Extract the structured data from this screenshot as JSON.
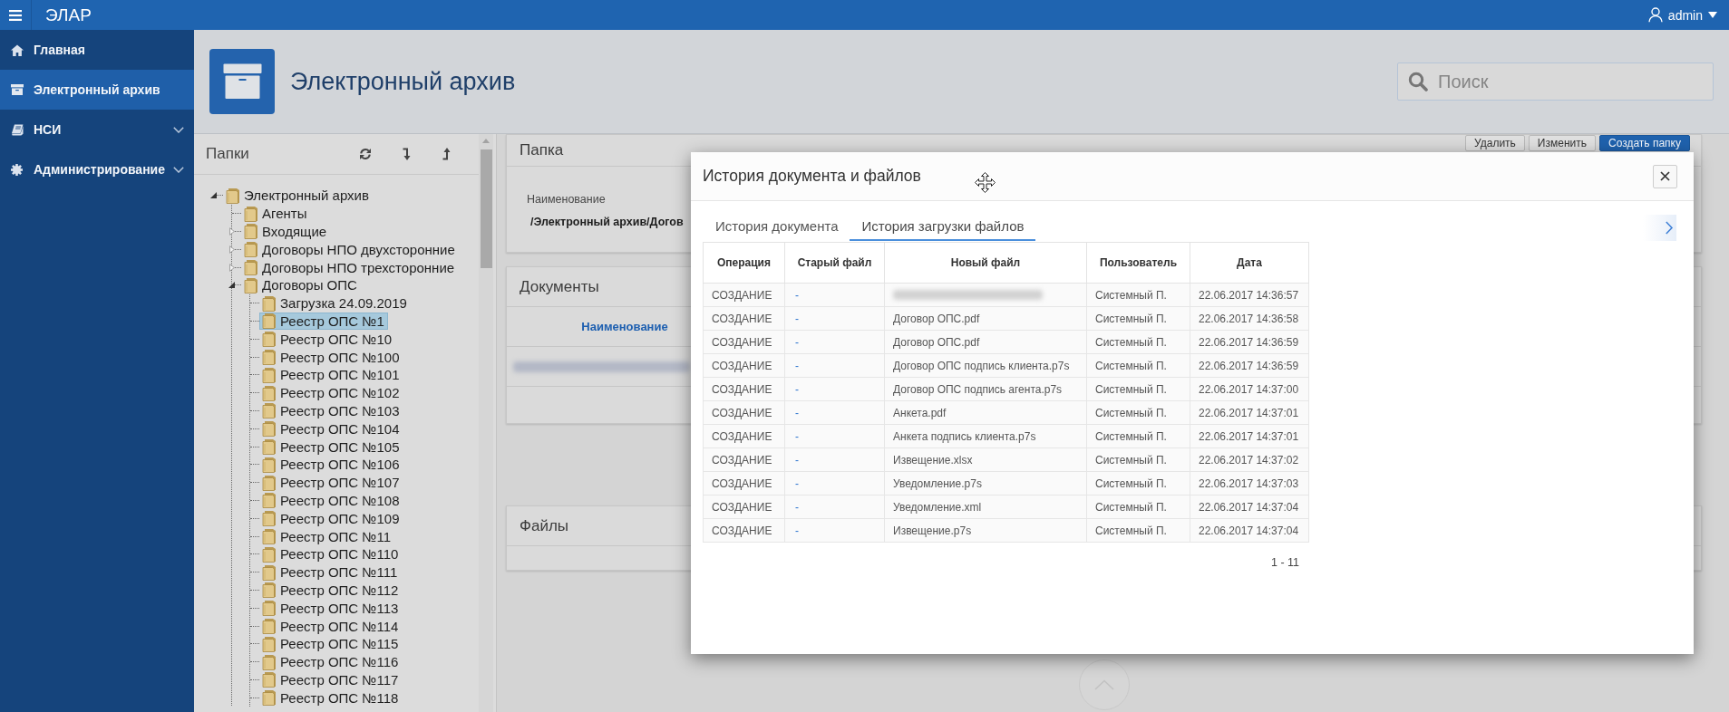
{
  "topbar": {
    "title": "ЭЛАР",
    "user": "admin"
  },
  "sidebar": {
    "items": [
      {
        "label": "Главная",
        "selected": false,
        "has_submenu": false
      },
      {
        "label": "Электронный архив",
        "selected": true,
        "has_submenu": false
      },
      {
        "label": "НСИ",
        "selected": false,
        "has_submenu": true
      },
      {
        "label": "Администрирование",
        "selected": false,
        "has_submenu": true
      }
    ]
  },
  "page_header": {
    "title": "Электронный архив",
    "search": {
      "placeholder": "Поиск"
    }
  },
  "folders_panel": {
    "title": "Папки",
    "tree": [
      {
        "label": "Электронный архив",
        "expanded": true,
        "selected": false,
        "children": [
          {
            "label": "Агенты",
            "selected": false
          },
          {
            "label": "Входящие",
            "expanded": false,
            "selected": false
          },
          {
            "label": "Договоры НПО двухсторонние",
            "expanded": false,
            "selected": false
          },
          {
            "label": "Договоры НПО трехсторонние",
            "expanded": false,
            "selected": false
          },
          {
            "label": "Договоры ОПС",
            "expanded": true,
            "selected": false,
            "children": [
              {
                "label": "Загрузка 24.09.2019",
                "selected": false
              },
              {
                "label": "Реестр ОПС №1",
                "selected": true
              },
              {
                "label": "Реестр ОПС №10",
                "selected": false
              },
              {
                "label": "Реестр ОПС №100",
                "selected": false
              },
              {
                "label": "Реестр ОПС №101",
                "selected": false
              },
              {
                "label": "Реестр ОПС №102",
                "selected": false
              },
              {
                "label": "Реестр ОПС №103",
                "selected": false
              },
              {
                "label": "Реестр ОПС №104",
                "selected": false
              },
              {
                "label": "Реестр ОПС №105",
                "selected": false
              },
              {
                "label": "Реестр ОПС №106",
                "selected": false
              },
              {
                "label": "Реестр ОПС №107",
                "selected": false
              },
              {
                "label": "Реестр ОПС №108",
                "selected": false
              },
              {
                "label": "Реестр ОПС №109",
                "selected": false
              },
              {
                "label": "Реестр ОПС №11",
                "selected": false
              },
              {
                "label": "Реестр ОПС №110",
                "selected": false
              },
              {
                "label": "Реестр ОПС №111",
                "selected": false
              },
              {
                "label": "Реестр ОПС №112",
                "selected": false
              },
              {
                "label": "Реестр ОПС №113",
                "selected": false
              },
              {
                "label": "Реестр ОПС №114",
                "selected": false
              },
              {
                "label": "Реестр ОПС №115",
                "selected": false
              },
              {
                "label": "Реестр ОПС №116",
                "selected": false
              },
              {
                "label": "Реестр ОПС №117",
                "selected": false
              },
              {
                "label": "Реестр ОПС №118",
                "selected": false
              }
            ]
          }
        ]
      }
    ]
  },
  "folder_panel": {
    "title": "Папка",
    "buttons": [
      {
        "label": "Удалить",
        "kind": "default"
      },
      {
        "label": "Изменить",
        "kind": "default"
      },
      {
        "label": "Создать папку",
        "kind": "primary"
      }
    ],
    "field_label": "Наименование",
    "field_value": "/Электронный архив/Догов"
  },
  "documents_panel": {
    "title": "Документы",
    "columns": [
      "Наименование"
    ],
    "rows": [
      {
        "name_blurred": true
      }
    ]
  },
  "files_panel": {
    "title": "Файлы"
  },
  "dialog": {
    "title": "История документа и файлов",
    "tabs": [
      {
        "label": "История документа",
        "selected": false
      },
      {
        "label": "История загрузки файлов",
        "selected": true
      }
    ],
    "table": {
      "columns": [
        "Операция",
        "Старый файл",
        "Новый файл",
        "Пользователь",
        "Дата"
      ],
      "rows": [
        {
          "operation": "СОЗДАНИЕ",
          "old_file": "-",
          "new_file_blurred": true,
          "user": "Системный П.",
          "date": "22.06.2017 14:36:57"
        },
        {
          "operation": "СОЗДАНИЕ",
          "old_file": "-",
          "new_file_blurred": false,
          "new_file": "Договор ОПС.pdf",
          "user": "Системный П.",
          "date": "22.06.2017 14:36:58"
        },
        {
          "operation": "СОЗДАНИЕ",
          "old_file": "-",
          "new_file_blurred": false,
          "new_file": "Договор ОПС.pdf",
          "user": "Системный П.",
          "date": "22.06.2017 14:36:59"
        },
        {
          "operation": "СОЗДАНИЕ",
          "old_file": "-",
          "new_file_blurred": false,
          "new_file": "Договор ОПС подпись клиента.p7s",
          "user": "Системный П.",
          "date": "22.06.2017 14:36:59"
        },
        {
          "operation": "СОЗДАНИЕ",
          "old_file": "-",
          "new_file_blurred": false,
          "new_file": "Договор ОПС подпись агента.p7s",
          "user": "Системный П.",
          "date": "22.06.2017 14:37:00"
        },
        {
          "operation": "СОЗДАНИЕ",
          "old_file": "-",
          "new_file_blurred": false,
          "new_file": "Анкета.pdf",
          "user": "Системный П.",
          "date": "22.06.2017 14:37:01"
        },
        {
          "operation": "СОЗДАНИЕ",
          "old_file": "-",
          "new_file_blurred": false,
          "new_file": "Анкета подпись клиента.p7s",
          "user": "Системный П.",
          "date": "22.06.2017 14:37:01"
        },
        {
          "operation": "СОЗДАНИЕ",
          "old_file": "-",
          "new_file_blurred": false,
          "new_file": "Извещение.xlsx",
          "user": "Системный П.",
          "date": "22.06.2017 14:37:02"
        },
        {
          "operation": "СОЗДАНИЕ",
          "old_file": "-",
          "new_file_blurred": false,
          "new_file": "Уведомление.p7s",
          "user": "Системный П.",
          "date": "22.06.2017 14:37:03"
        },
        {
          "operation": "СОЗДАНИЕ",
          "old_file": "-",
          "new_file_blurred": false,
          "new_file": "Уведомление.xml",
          "user": "Системный П.",
          "date": "22.06.2017 14:37:04"
        },
        {
          "operation": "СОЗДАНИЕ",
          "old_file": "-",
          "new_file_blurred": false,
          "new_file": "Извещение.p7s",
          "user": "Системный П.",
          "date": "22.06.2017 14:37:04"
        }
      ]
    },
    "pager": "1 - 11"
  }
}
